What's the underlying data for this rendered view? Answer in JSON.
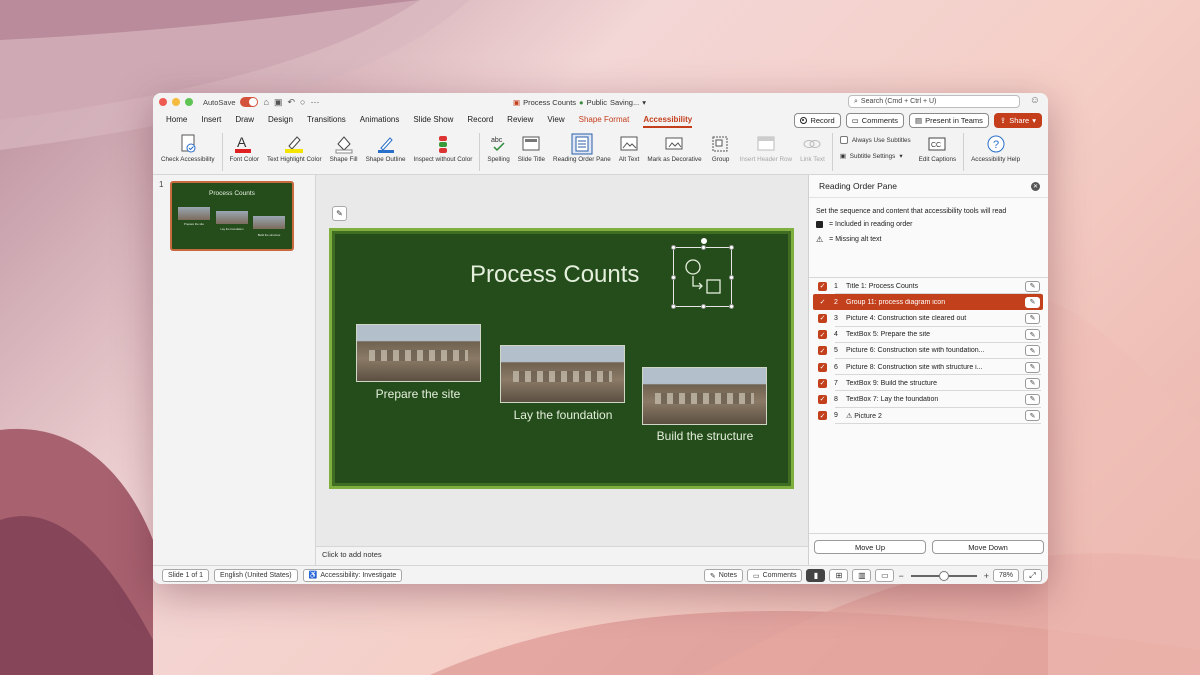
{
  "colors": {
    "accent": "#c43e1c",
    "slide_bg": "#254d1c",
    "slide_text": "#e4efdc"
  },
  "titlebar": {
    "autosave_label": "AutoSave",
    "doc_title": "Process Counts",
    "privacy": "Public",
    "saving": "Saving...",
    "search_placeholder": "Search (Cmd + Ctrl + U)"
  },
  "menu": {
    "tabs": [
      "Home",
      "Insert",
      "Draw",
      "Design",
      "Transitions",
      "Animations",
      "Slide Show",
      "Record",
      "Review",
      "View",
      "Shape Format",
      "Accessibility"
    ],
    "record": "Record",
    "comments": "Comments",
    "present_teams": "Present in Teams",
    "share": "Share"
  },
  "ribbon": {
    "check": "Check Accessibility",
    "font_color": "Font Color",
    "highlight": "Text Highlight Color",
    "shape_fill": "Shape Fill",
    "shape_outline": "Shape Outline",
    "inspect": "Inspect without Color",
    "spelling": "Spelling",
    "slide_title": "Slide Title",
    "reading_order": "Reading Order Pane",
    "alt_text": "Alt Text",
    "mark_decorative": "Mark as Decorative",
    "group": "Group",
    "insert_header": "Insert Header Row",
    "link_text": "Link Text",
    "always_subtitles": "Always Use Subtitles",
    "subtitle_settings": "Subtitle Settings",
    "edit_captions": "Edit Captions",
    "accessibility_help": "Accessibility Help"
  },
  "thumbnail": {
    "number": "1",
    "title": "Process Counts",
    "captions": [
      "Prepare the site",
      "Lay the foundation",
      "Build the structure"
    ]
  },
  "slide": {
    "title": "Process Counts",
    "captions": [
      "Prepare the site",
      "Lay the foundation",
      "Build the structure"
    ]
  },
  "notes_placeholder": "Click to add notes",
  "pane": {
    "title": "Reading Order Pane",
    "description": "Set the sequence and content that accessibility tools will read",
    "legend_included": "= Included in reading order",
    "legend_missing": "= Missing alt text",
    "items": [
      {
        "num": "1",
        "label": "Title 1: Process Counts"
      },
      {
        "num": "2",
        "label": "Group 11: process diagram icon"
      },
      {
        "num": "3",
        "label": "Picture 4: Construction site cleared out"
      },
      {
        "num": "4",
        "label": "TextBox 5: Prepare the site"
      },
      {
        "num": "5",
        "label": "Picture 6: Construction site with foundation..."
      },
      {
        "num": "6",
        "label": "Picture 8: Construction site with structure i..."
      },
      {
        "num": "7",
        "label": "TextBox 9: Build the structure"
      },
      {
        "num": "8",
        "label": "TextBox 7: Lay the foundation"
      },
      {
        "num": "9",
        "label": "⚠ Picture 2"
      }
    ],
    "selected_index": 1,
    "move_up": "Move Up",
    "move_down": "Move Down"
  },
  "status": {
    "slide": "Slide 1 of 1",
    "language": "English (United States)",
    "accessibility": "Accessibility: Investigate",
    "notes": "Notes",
    "comments": "Comments",
    "zoom": "78%",
    "zoom_level": 0.5
  }
}
